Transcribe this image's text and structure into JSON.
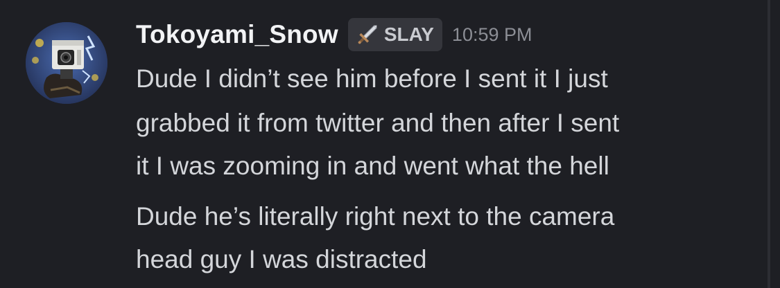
{
  "message": {
    "author": "Tokoyami_Snow",
    "tag": {
      "icon": "sword-icon",
      "label": "SLAY"
    },
    "timestamp": "10:59 PM",
    "messages": [
      {
        "lines": [
          "Dude I didn’t see him before I sent it I just",
          "grabbed it from twitter and then after I sent",
          "it I was zooming in and went what the hell"
        ]
      },
      {
        "lines": [
          "Dude he’s literally right next to the camera",
          "head guy I was distracted"
        ]
      }
    ]
  },
  "colors": {
    "background": "#1e1f24",
    "username": "#f2f3f5",
    "message_text": "#d4d6da",
    "timestamp": "#8c8e95",
    "tag_background": "#35363c"
  }
}
